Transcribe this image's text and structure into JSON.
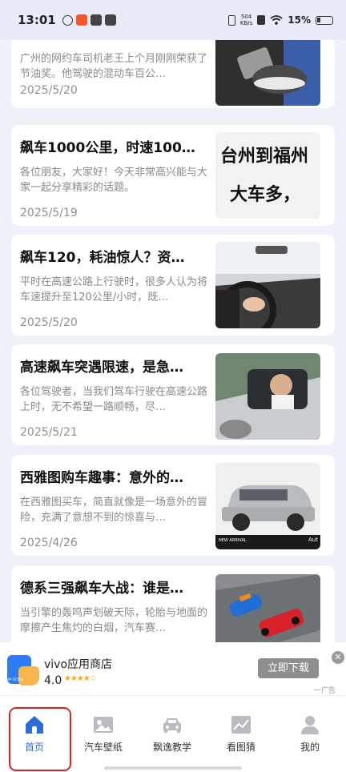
{
  "status_bar": {
    "time": "13:01",
    "net_speed_value": "504",
    "net_speed_unit": "KB/s",
    "battery": "15%"
  },
  "articles": [
    {
      "title": "",
      "summary": "广州的网约车司机老王上个月刚刚荣获了节油奖。他驾驶的混动车百公…",
      "date": "2025/5/20",
      "thumb_icon": "pedals-shoe-image"
    },
    {
      "title": "飙车1000公里，时速100…",
      "summary": "各位朋友，大家好！今天非常高兴能与大家一起分享精彩的话题。",
      "date": "2025/5/19",
      "thumb_icon": "text-banner-image",
      "thumb_text_1": "台州到福州",
      "thumb_text_2": "大车多，"
    },
    {
      "title": "飙车120，耗油惊人？资…",
      "summary": "平时在高速公路上行驶时，很多人认为将车速提升至120公里/小时，既…",
      "date": "2025/5/20",
      "thumb_icon": "steering-wheel-image"
    },
    {
      "title": "高速飙车突遇限速，是急…",
      "summary": "各位驾驶者，当我们驾车行驶在高速公路上时，无不希望一路顺畅，尽…",
      "date": "2025/5/21",
      "thumb_icon": "driver-car-image"
    },
    {
      "title": "西雅图购车趣事：意外的…",
      "summary": "在西雅图买车，简直就像是一场意外的冒险，充满了意想不到的惊喜与…",
      "date": "2025/4/26",
      "thumb_icon": "suv-image",
      "thumb_caption": "NEW ARRIVAL",
      "thumb_corner": "Aut"
    },
    {
      "title": "德系三强飙车大战：谁是…",
      "summary": "当引擎的轰鸣声划破天际，轮胎与地面的摩擦产生焦灼的白烟，汽车赛…",
      "date": "",
      "thumb_icon": "race-cars-image"
    }
  ],
  "ad": {
    "app_name": "vivo应用商店",
    "rating": "4.0",
    "stars": "★★★★☆",
    "button": "立即下载",
    "close": "✕",
    "tag": "一广告",
    "logo_text": "APP STORE"
  },
  "bottom_nav": {
    "items": [
      {
        "label": "首页",
        "icon": "home-icon"
      },
      {
        "label": "汽车壁纸",
        "icon": "image-icon"
      },
      {
        "label": "飘逸教学",
        "icon": "car-icon"
      },
      {
        "label": "看图猜",
        "icon": "chart-image-icon"
      },
      {
        "label": "我的",
        "icon": "user-icon"
      }
    ],
    "active_index": 0
  },
  "colors": {
    "accent": "#2f6bd8",
    "highlight": "#e02222",
    "background": "#eef1f8"
  }
}
